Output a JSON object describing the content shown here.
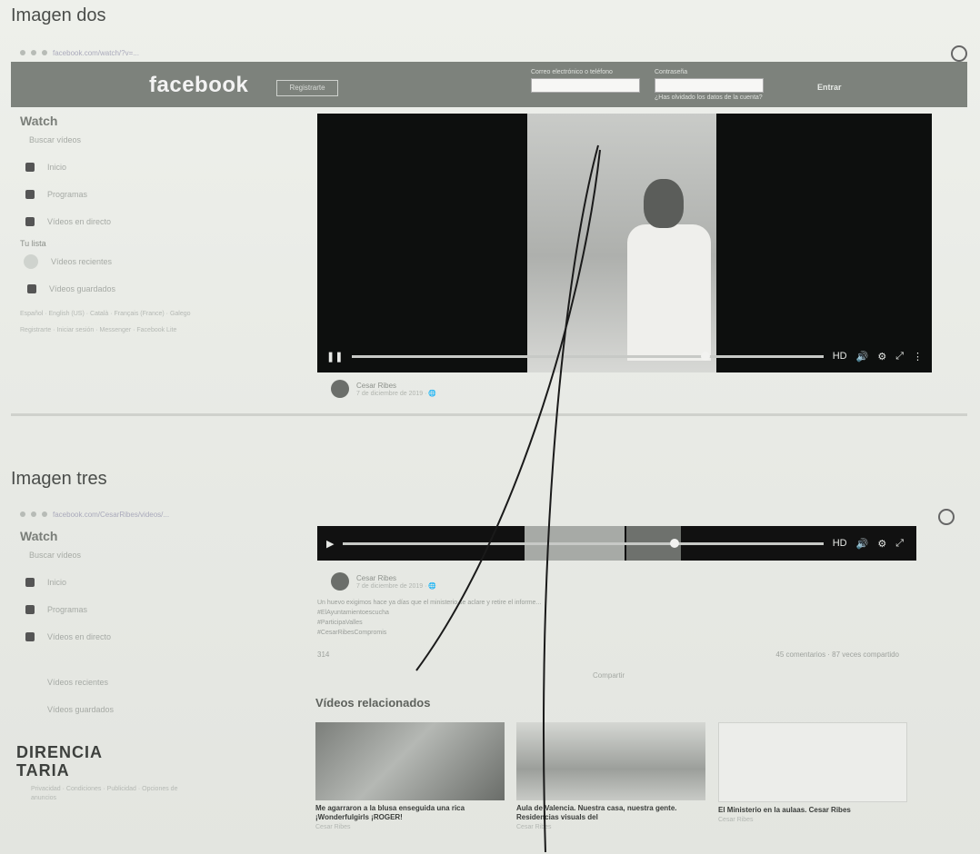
{
  "headings": {
    "top": "Imagen dos",
    "bottom": "Imagen tres"
  },
  "top_screen": {
    "url_text": "facebook.com/watch/?v=...",
    "brand": "facebook",
    "header_button": "Registrarte",
    "login_label_email": "Correo electrónico o teléfono",
    "login_label_password": "Contraseña",
    "forgot_link": "¿Has olvidado los datos de la cuenta?",
    "login_button": "Entrar",
    "sidebar": {
      "title": "Watch",
      "search_placeholder": "Buscar vídeos",
      "items": [
        "Inicio",
        "Programas",
        "Vídeos en directo"
      ],
      "section": "Tu lista",
      "items2": [
        "Vídeos recientes",
        "Vídeos guardados"
      ],
      "footer1": "Español · English (US) · Català · Français (France) · Galego",
      "footer2": "Registrarte · Iniciar sesión · Messenger · Facebook Lite"
    },
    "video": {
      "progress": 0.74
    },
    "poster": {
      "name": "Cesar Ribes",
      "meta": "7 de diciembre de 2019 · 🌐"
    }
  },
  "bottom_screen": {
    "url_text": "facebook.com/CesarRibes/videos/...",
    "sidebar": {
      "title": "Watch",
      "search_placeholder": "Buscar vídeos",
      "items": [
        "Inicio",
        "Programas",
        "Vídeos en directo"
      ],
      "items2": [
        "Vídeos recientes",
        "Vídeos guardados"
      ],
      "footer": "Privacidad · Condiciones · Publicidad · Opciones de anuncios"
    },
    "poster": {
      "name": "Cesar Ribes",
      "meta": "7 de diciembre de 2019 · 🌐"
    },
    "post_text": "Un huevo exigimos hace ya días que el ministerio se aclare y retire el informe...",
    "hashtags": [
      "#ElAyuntamientoescucha",
      "#ParticipaValles",
      "#CesarRibesCompromis"
    ],
    "reactions": "314",
    "comments": "45 comentarios · 87 veces compartido",
    "share": "Compartir",
    "related_title": "Vídeos relacionados",
    "related": [
      {
        "caption": "Me agarraron a la blusa enseguida una rica ¡Wonderfulgirls ¡ROGER!",
        "sub": "Cesar Ribes"
      },
      {
        "caption": "Aula de Valencia. Nuestra casa, nuestra gente. Residencias visuals del",
        "sub": "Cesar Ribes"
      },
      {
        "caption": "El Ministerio en la aulaas. Cesar Ribes",
        "sub": "Cesar Ribes"
      }
    ],
    "stamp": "DIRENCIA\nTARIA"
  }
}
